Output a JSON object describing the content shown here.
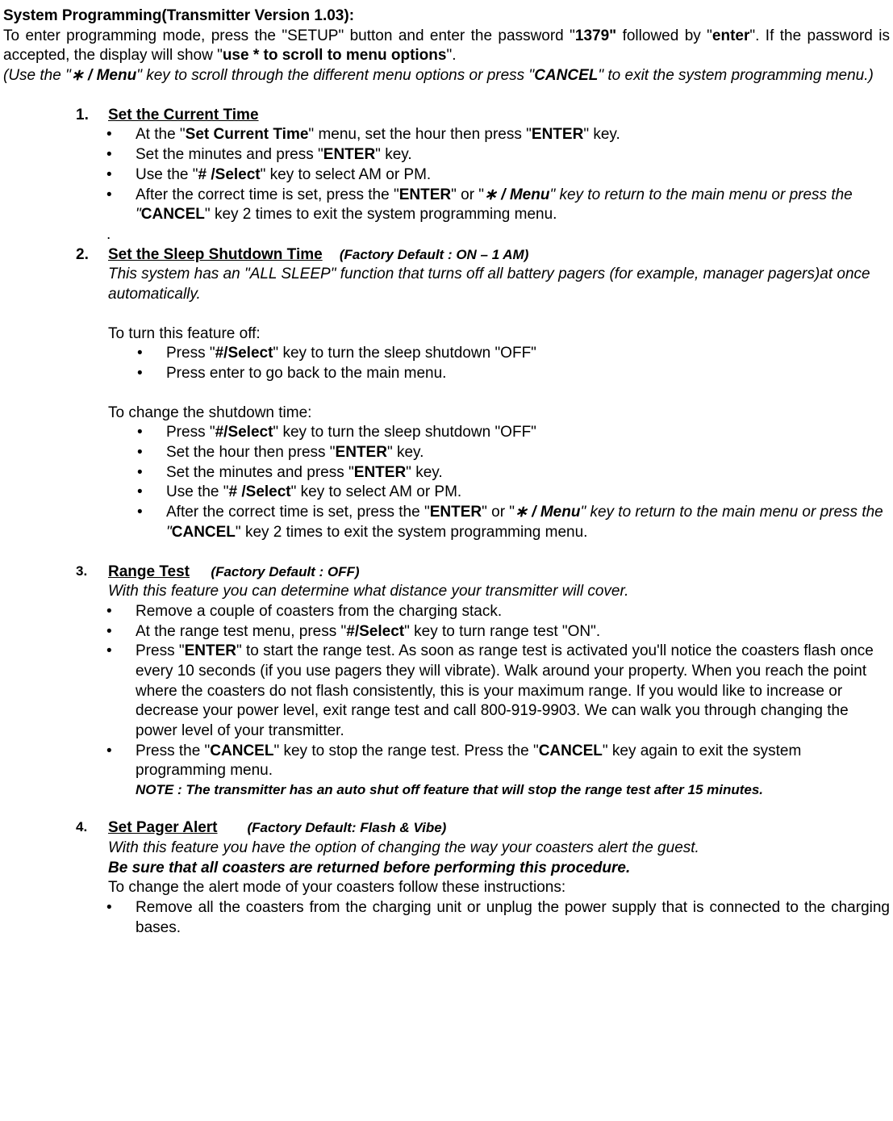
{
  "header": {
    "title_prefix": "System Programming(Transmitter Version 1.03):",
    "line1_a": "To enter programming mode, press the \"SETUP\" button and enter the password \"",
    "line1_b": "1379\"",
    "line1_c": " followed by \"",
    "line1_d": "enter",
    "line1_e": "\".    If the password is accepted, the display will show \"",
    "line1_f": "use * to scroll to menu options",
    "line1_g": "\".",
    "line2_a": " (Use the   \"",
    "line2_b": "∗ / Menu",
    "line2_c": "\" key to scroll through the different menu options or press \"",
    "line2_d": "CANCEL",
    "line2_e": "\" to exit the system programming menu.)"
  },
  "s1": {
    "num": "1.",
    "title": "Set the Current Time",
    "b1_a": "At the \"",
    "b1_b": "Set Current Time",
    "b1_c": "\" menu, set the hour then press \"",
    "b1_d": "ENTER",
    "b1_e": "\" key.",
    "b2_a": "Set the minutes and press    \"",
    "b2_b": "ENTER",
    "b2_c": "\" key.",
    "b3_a": "Use the \"",
    "b3_b": "# /Select",
    "b3_c": "\" key to select AM or PM.",
    "b4_a": "After the correct time is set, press the \"",
    "b4_b": "ENTER",
    "b4_c": "\" or \"",
    "b4_d": "∗ / Menu",
    "b4_e": "\" key to return to the main menu or press the \"",
    "b4_f": "CANCEL",
    "b4_g": "\" key 2 times to exit the system programming menu.",
    "dot": "."
  },
  "s2": {
    "num": "2.",
    "title": "Set the Sleep Shutdown Time",
    "default": "(Factory Default : ON – 1 AM)",
    "desc": "This system has an \"ALL SLEEP\" function that turns off all battery pagers (for example, manager pagers)at once automatically.",
    "off_label": "To turn this feature off:",
    "off_b1_a": "Press \"",
    "off_b1_b": "#/Select",
    "off_b1_c": "\" key to turn the sleep shutdown \"OFF\"",
    "off_b2": "Press enter to go back to the main menu.",
    "chg_label": "To change the shutdown time:",
    "chg_b1_a": "Press \"",
    "chg_b1_b": "#/Select",
    "chg_b1_c": "\" key to turn the sleep shutdown \"OFF\"",
    "chg_b2_a": "Set the hour then press \"",
    "chg_b2_b": "ENTER",
    "chg_b2_c": "\" key.",
    "chg_b3_a": "Set the minutes and press    \"",
    "chg_b3_b": "ENTER",
    "chg_b3_c": "\" key.",
    "chg_b4_a": "Use the \"",
    "chg_b4_b": "# /Select",
    "chg_b4_c": "\" key to select AM or PM.",
    "chg_b5_a": "After the correct time is set, press the \"",
    "chg_b5_b": "ENTER",
    "chg_b5_c": "\" or \"",
    "chg_b5_d": "∗ / Menu",
    "chg_b5_e": "\" key to return to the main menu or press the \"",
    "chg_b5_f": "CANCEL",
    "chg_b5_g": "\" key 2 times to exit the system programming menu."
  },
  "s3": {
    "num": "3.",
    "title": "Range Test",
    "default": "(Factory Default : OFF)",
    "desc": "With this feature you can determine what distance your transmitter will cover.",
    "b1": "Remove a couple of coasters from the charging stack.",
    "b2_a": "At the range test menu, press \"",
    "b2_b": "#/Select",
    "b2_c": "\" key to turn range test \"ON\".",
    "b3_a": "Press    \"",
    "b3_b": "ENTER",
    "b3_c": "\" to start the range test.    As soon as range test is activated you'll notice the coasters flash once every 10 seconds (if you use pagers they will vibrate). Walk around your property. When you reach the point where the coasters do not flash consistently, this is your maximum range.    If you would like to increase or decrease your power level, exit range test and call 800-919-9903. We can walk you through changing the power level of your transmitter.",
    "b4_a": "Press    the \"",
    "b4_b": "CANCEL",
    "b4_c": "\" key to stop the range test.    Press the \"",
    "b4_d": "CANCEL",
    "b4_e": "\" key again to exit the system programming menu.",
    "note": "NOTE : The transmitter has an auto shut off feature that will stop the range test after 15 minutes."
  },
  "s4": {
    "num": "4.",
    "title": "Set Pager Alert",
    "default": "(Factory Default: Flash & Vibe)",
    "desc": "With this feature you have the option of changing the way your coasters alert the guest.",
    "warn": "Be sure that all coasters are returned before performing this procedure.",
    "instr": "To change the alert mode of your coasters follow these instructions:",
    "b1": "Remove all the coasters from the charging unit or unplug the power supply that is connected to the charging bases."
  }
}
